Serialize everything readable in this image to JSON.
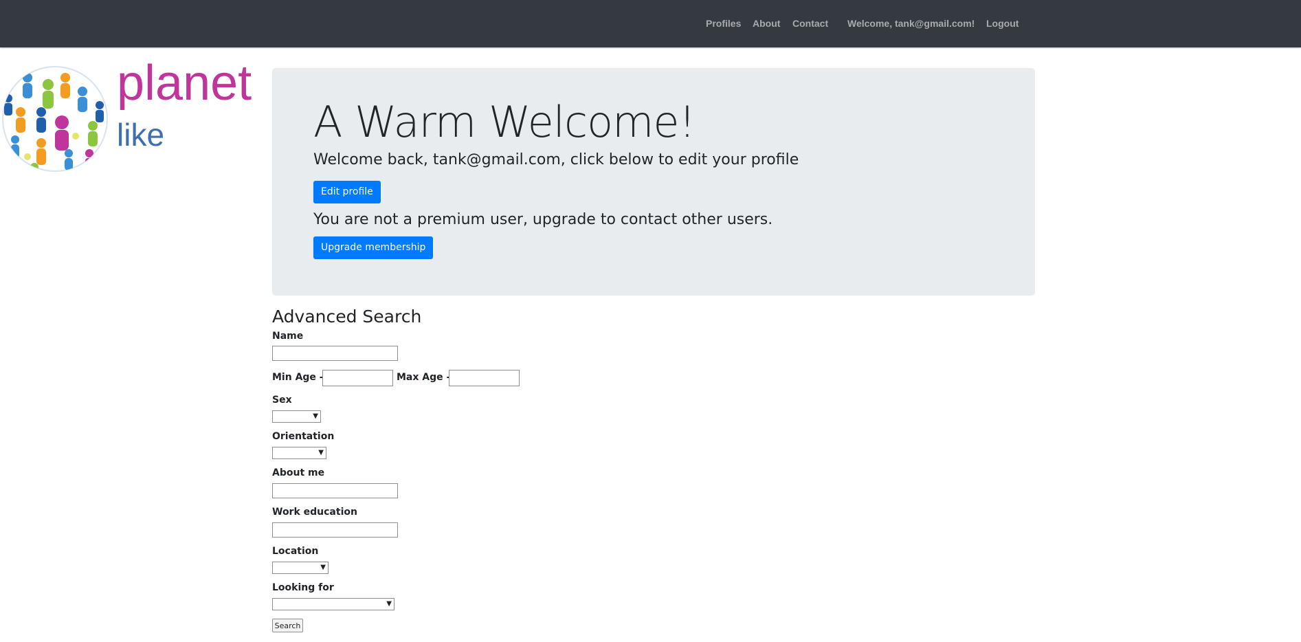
{
  "nav": {
    "profiles": "Profiles",
    "about": "About",
    "contact": "Contact",
    "welcome": "Welcome, tank@gmail.com!",
    "logout": "Logout"
  },
  "logo": {
    "word1": "planet",
    "word2": "like"
  },
  "jumbotron": {
    "title": "A Warm Welcome!",
    "welcome_text": "Welcome back, tank@gmail.com, click below to edit your profile",
    "edit_button": "Edit profile",
    "premium_text": "You are not a premium user, upgrade to contact other users.",
    "upgrade_button": "Upgrade membership"
  },
  "search": {
    "title": "Advanced Search",
    "name_label": "Name",
    "name_value": "",
    "min_age_label": "Min Age -",
    "min_age_value": "",
    "max_age_label": "Max Age -",
    "max_age_value": "",
    "sex_label": "Sex",
    "sex_value": "",
    "orientation_label": "Orientation",
    "orientation_value": "",
    "about_label": "About me",
    "about_value": "",
    "work_label": "Work education",
    "work_value": "",
    "location_label": "Location",
    "location_value": "",
    "looking_label": "Looking for",
    "looking_value": "",
    "search_button": "Search"
  },
  "colors": {
    "navbar": "#343a40",
    "primary": "#007bff",
    "jumbotron": "#e9ecef",
    "logo_magenta": "#c0359b",
    "logo_blue": "#3c6fb4"
  }
}
